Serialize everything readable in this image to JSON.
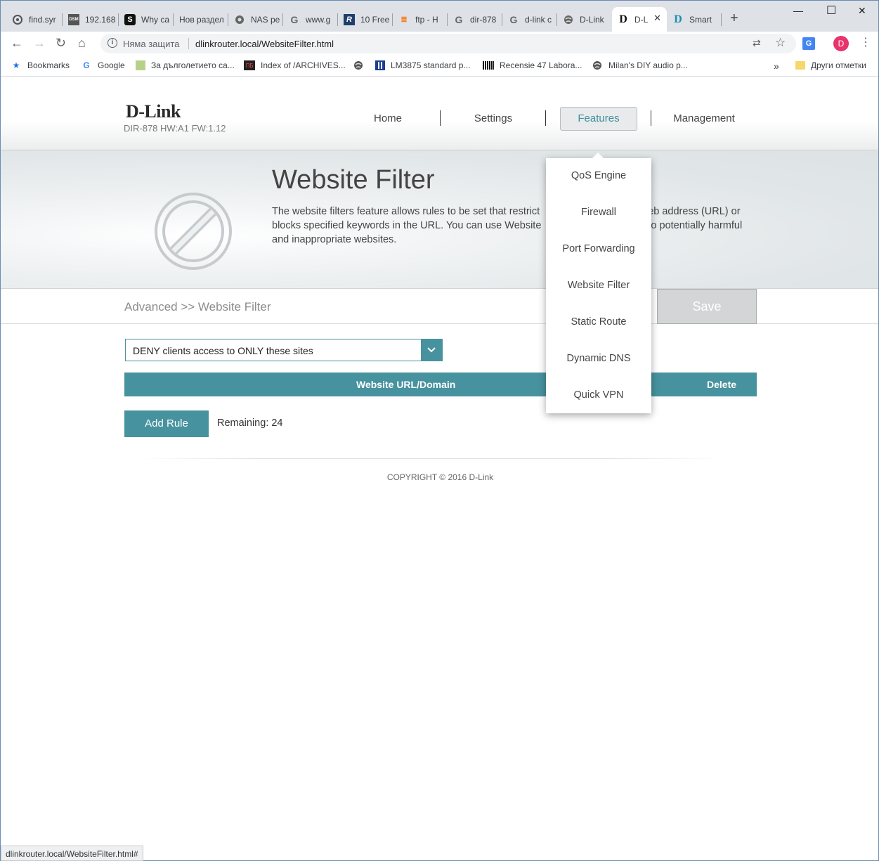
{
  "browser": {
    "tabs": [
      {
        "title": "find.syr",
        "icon": "gear-circle-icon"
      },
      {
        "title": "192.168",
        "icon": "dsm-icon"
      },
      {
        "title": "Why ca",
        "icon": "s-letter-icon"
      },
      {
        "title": "Нов раздел",
        "icon": ""
      },
      {
        "title": "NAS pe",
        "icon": "network-icon"
      },
      {
        "title": "www.g",
        "icon": "google-icon"
      },
      {
        "title": "10 Free",
        "icon": "r-letter-icon"
      },
      {
        "title": "ftp - H",
        "icon": "stack-overflow-icon"
      },
      {
        "title": "dir-878",
        "icon": "google-icon"
      },
      {
        "title": "d-link c",
        "icon": "google-icon"
      },
      {
        "title": "D-Link",
        "icon": "globe-icon"
      },
      {
        "title": "D-L",
        "icon": "dlink-icon",
        "active": true
      },
      {
        "title": "Smart",
        "icon": "dlink-blue-icon"
      }
    ],
    "address": {
      "security_label": "Няма защита",
      "url": "dlinkrouter.local/WebsiteFilter.html"
    },
    "avatar_letter": "D",
    "bookmarks": [
      {
        "label": "Bookmarks",
        "icon": "star-icon"
      },
      {
        "label": "Google",
        "icon": "google-icon"
      },
      {
        "label": "За дълголетието са...",
        "icon": "image-icon"
      },
      {
        "label": "Index of /ARCHIVES...",
        "icon": "archive-icon"
      },
      {
        "label": "",
        "icon": "globe-icon"
      },
      {
        "label": "LM3875 standard p...",
        "icon": "grid-icon"
      },
      {
        "label": "Recensie 47 Labora...",
        "icon": "barcode-icon"
      },
      {
        "label": "Milan's DIY audio p...",
        "icon": "globe-icon"
      }
    ],
    "other_bookmarks": "Други отметки",
    "status_url": "dlinkrouter.local/WebsiteFilter.html#"
  },
  "router": {
    "brand": "D-Link",
    "model": "DIR-878 HW:A1 FW:1.12",
    "nav": {
      "home": "Home",
      "settings": "Settings",
      "features": "Features",
      "management": "Management"
    },
    "features_menu": [
      "QoS Engine",
      "Firewall",
      "Port Forwarding",
      "Website Filter",
      "Static Route",
      "Dynamic DNS",
      "Quick VPN"
    ],
    "hero": {
      "title": "Website Filter",
      "desc_line1": "The website filters feature allows rules to be set that restrict",
      "desc_line1b": "eb address (URL) or",
      "desc_line2": "blocks specified keywords in the URL. You can use Website",
      "desc_line2b": "to potentially harmful",
      "desc_line3": "and inappropriate websites."
    },
    "breadcrumb": "Advanced >> Website Filter",
    "save_label": "Save",
    "filter_mode": "DENY clients access to ONLY these sites",
    "table": {
      "col_url": "Website URL/Domain",
      "col_delete": "Delete"
    },
    "add_rule_label": "Add Rule",
    "remaining": "Remaining: 24",
    "copyright": "COPYRIGHT © 2016 D-Link"
  },
  "colors": {
    "accent": "#47929f",
    "save_disabled": "#d3d5d6"
  }
}
